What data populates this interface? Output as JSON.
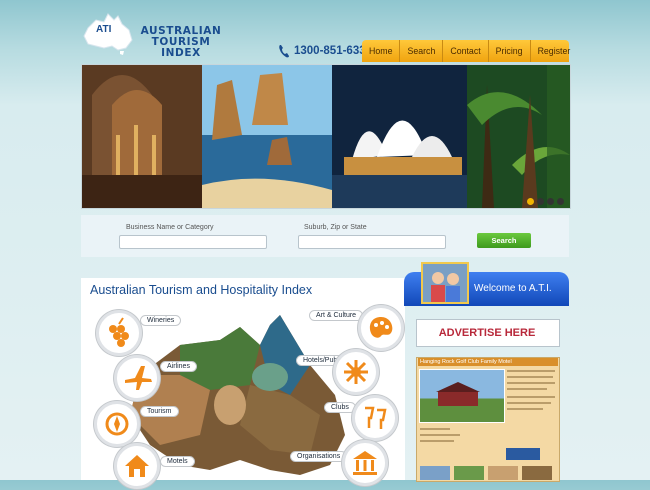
{
  "header": {
    "logo_badge": "ATI",
    "logo_line1": "AUSTRALIAN",
    "logo_line2": "TOURISM INDEX",
    "phone": "1300-851-633"
  },
  "nav": {
    "items": [
      {
        "label": "Home"
      },
      {
        "label": "Search"
      },
      {
        "label": "Contact"
      },
      {
        "label": "Pricing"
      },
      {
        "label": "Register"
      }
    ]
  },
  "search": {
    "label_business": "Business Name or Category",
    "label_location": "Suburb, Zip or State",
    "button": "Search"
  },
  "main": {
    "title": "Australian Tourism and Hospitality Index",
    "categories": [
      {
        "label": "Wineries",
        "icon": "grapes-icon"
      },
      {
        "label": "Airlines",
        "icon": "airplane-icon"
      },
      {
        "label": "Tourism",
        "icon": "compass-icon"
      },
      {
        "label": "Motels",
        "icon": "house-icon"
      },
      {
        "label": "Art & Culture",
        "icon": "palette-icon"
      },
      {
        "label": "Hotels/Pubs",
        "icon": "star-icon"
      },
      {
        "label": "Clubs",
        "icon": "glasses-icon"
      },
      {
        "label": "Organisations",
        "icon": "building-icon"
      }
    ]
  },
  "sidebar": {
    "welcome": "Welcome to A.T.I.",
    "advertise": "ADVERTISE HERE",
    "listing_title": "Hanging Rock Golf Club Family Motel"
  },
  "colors": {
    "accent_blue": "#1a4d8f",
    "nav_orange": "#f0a410",
    "search_green": "#3d9a1d",
    "advert_red": "#b8283a"
  }
}
